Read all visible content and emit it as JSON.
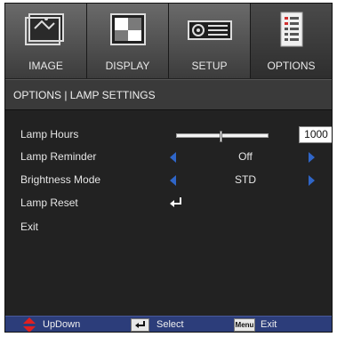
{
  "tabs": [
    {
      "label": "IMAGE",
      "icon": "image-icon",
      "active": false
    },
    {
      "label": "DISPLAY",
      "icon": "display-icon",
      "active": false
    },
    {
      "label": "SETUP",
      "icon": "setup-icon",
      "active": false
    },
    {
      "label": "OPTIONS",
      "icon": "options-icon",
      "active": true
    }
  ],
  "section": {
    "title": "OPTIONS | LAMP SETTINGS"
  },
  "rows": {
    "lamp_hours": {
      "label": "Lamp Hours",
      "value": "1000",
      "slider_fraction": 0.47
    },
    "lamp_reminder": {
      "label": "Lamp Reminder",
      "value": "Off"
    },
    "brightness_mode": {
      "label": "Brightness Mode",
      "value": "STD"
    },
    "lamp_reset": {
      "label": "Lamp Reset"
    },
    "exit": {
      "label": "Exit"
    }
  },
  "help": {
    "updown_label": "UpDown",
    "select_label": "Select",
    "menu_key": "Menu",
    "exit_label": "Exit"
  },
  "colors": {
    "accent_arrow": "#2f66c8",
    "help_bar": "#2c3d7a",
    "updown_icon": "#e02020"
  }
}
